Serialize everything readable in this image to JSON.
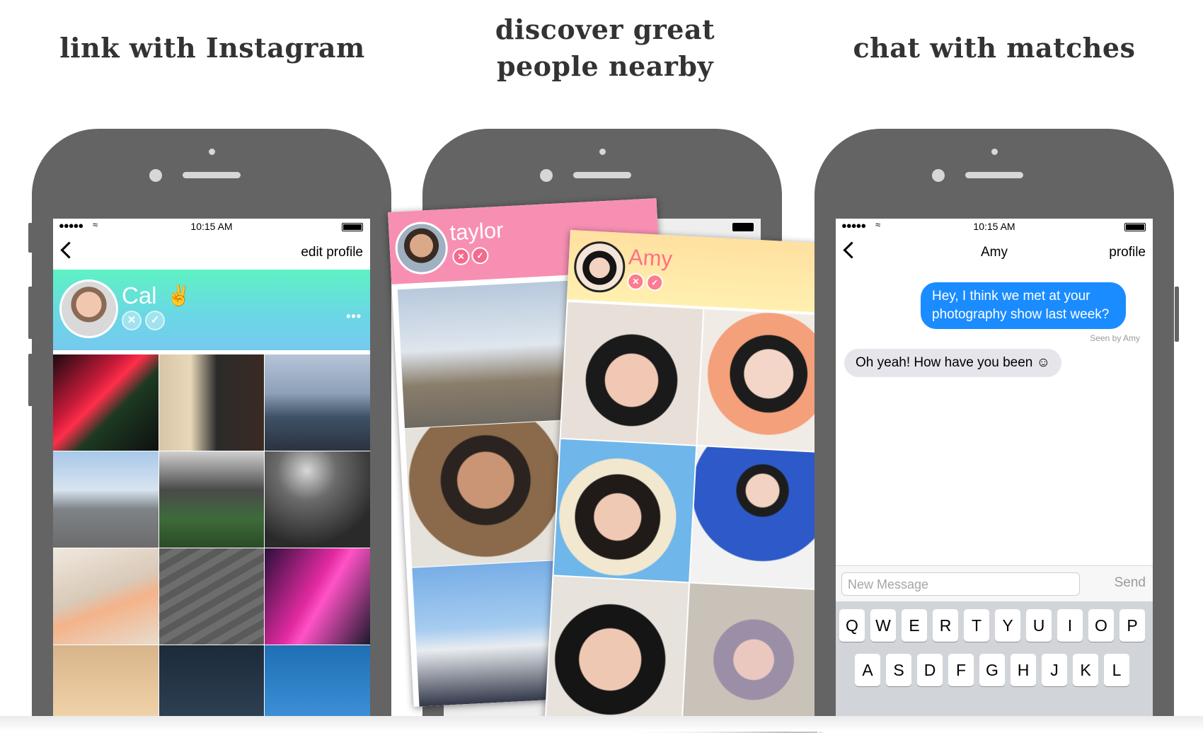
{
  "headlines": {
    "left": "link with Instagram",
    "middle_line1": "discover great",
    "middle_line2": "people nearby",
    "right": "chat with matches"
  },
  "status_bar": {
    "signal": "●●●●● ",
    "wifi": "≈",
    "time": "10:15 AM"
  },
  "profile_screen": {
    "nav_right": "edit profile",
    "name": "Cal",
    "name_emoji": "✌",
    "more": "•••",
    "reject_glyph": "✕",
    "accept_glyph": "✓",
    "header_gradient": [
      "#5ef2c4",
      "#76c9f0"
    ]
  },
  "discover_screen": {
    "back_card": {
      "name": "taylor",
      "reject_glyph": "✕",
      "accept_glyph": "✓",
      "color": "#f78fb3"
    },
    "front_card": {
      "name": "Amy",
      "reject_glyph": "✕",
      "accept_glyph": "✓",
      "more": "•••",
      "color": "#ffd79a",
      "name_color": "#ff6f87"
    }
  },
  "chat_screen": {
    "nav_title": "Amy",
    "nav_right": "profile",
    "messages": [
      {
        "from": "me",
        "text_line1": "Hey, I think we met at your",
        "text_line2": "photography show last week?"
      },
      {
        "from": "them",
        "text": "Oh yeah! How have you been ☺"
      }
    ],
    "read_receipt": "Seen by Amy",
    "input_placeholder": "New Message",
    "send_label": "Send",
    "keyboard_row1": [
      "Q",
      "W",
      "E",
      "R",
      "T",
      "Y",
      "U",
      "I",
      "O",
      "P"
    ],
    "keyboard_row2": [
      "A",
      "S",
      "D",
      "F",
      "G",
      "H",
      "J",
      "K",
      "L"
    ],
    "outgoing_color": "#1a8cff",
    "incoming_color": "#e6e5eb"
  }
}
